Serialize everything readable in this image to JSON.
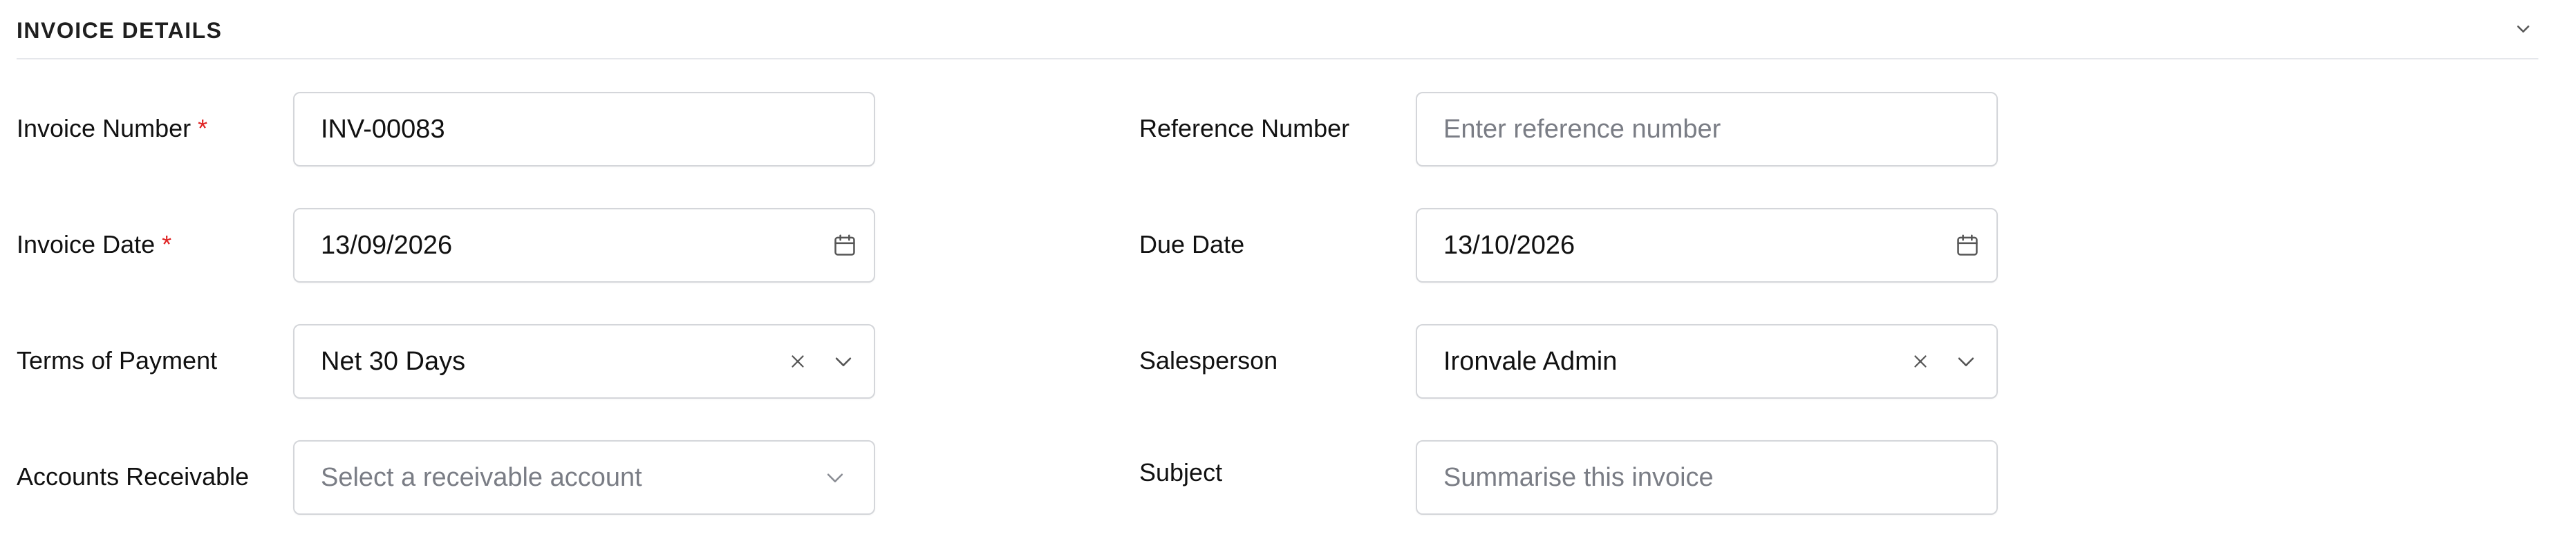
{
  "section": {
    "title": "INVOICE DETAILS",
    "collapse_icon": "chevron-down-icon"
  },
  "required_marker": "*",
  "fields": {
    "invoice_number": {
      "label": "Invoice Number",
      "required": true,
      "value": "INV-00083"
    },
    "reference_number": {
      "label": "Reference Number",
      "placeholder": "Enter reference number",
      "value": ""
    },
    "invoice_date": {
      "label": "Invoice Date",
      "required": true,
      "value": "13/09/2026",
      "icon": "calendar-icon"
    },
    "due_date": {
      "label": "Due Date",
      "value": "13/10/2026",
      "icon": "calendar-icon"
    },
    "terms_of_payment": {
      "label": "Terms of Payment",
      "value": "Net 30 Days",
      "clear_icon": "close-icon",
      "dropdown_icon": "chevron-down-icon"
    },
    "salesperson": {
      "label": "Salesperson",
      "value": "Ironvale Admin",
      "clear_icon": "close-icon",
      "dropdown_icon": "chevron-down-icon"
    },
    "accounts_receivable": {
      "label": "Accounts Receivable",
      "placeholder": "Select a receivable account",
      "dropdown_icon": "chevron-down-icon"
    },
    "subject": {
      "label": "Subject",
      "placeholder": "Summarise this invoice",
      "value": ""
    }
  },
  "colors": {
    "required": "#e02424",
    "border": "#d4d6da",
    "placeholder": "#7a7d85"
  }
}
